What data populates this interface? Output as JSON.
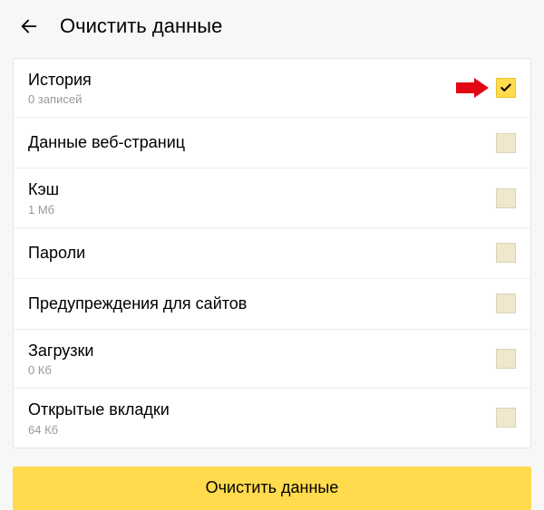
{
  "header": {
    "title": "Очистить данные"
  },
  "items": [
    {
      "label": "История",
      "sub": "0 записей",
      "checked": true,
      "annotated": true
    },
    {
      "label": "Данные веб-страниц",
      "sub": "",
      "checked": false,
      "annotated": false
    },
    {
      "label": "Кэш",
      "sub": "1 Мб",
      "checked": false,
      "annotated": false
    },
    {
      "label": "Пароли",
      "sub": "",
      "checked": false,
      "annotated": false
    },
    {
      "label": "Предупреждения для сайтов",
      "sub": "",
      "checked": false,
      "annotated": false
    },
    {
      "label": "Загрузки",
      "sub": "0 Кб",
      "checked": false,
      "annotated": false
    },
    {
      "label": "Открытые вкладки",
      "sub": "64 Кб",
      "checked": false,
      "annotated": false
    }
  ],
  "button": {
    "label": "Очистить данные"
  }
}
